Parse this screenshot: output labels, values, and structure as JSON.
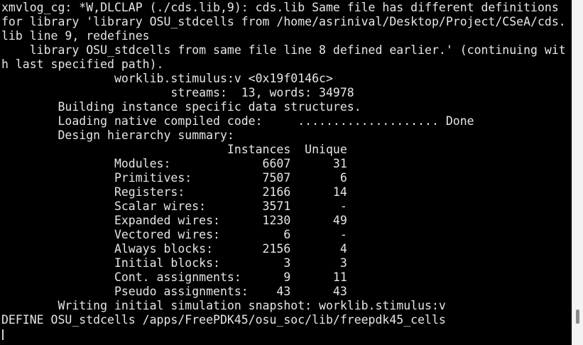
{
  "terminal": {
    "lines": [
      "xmvlog_cg: *W,DLCLAP (./cds.lib,9): cds.lib Same file has different definitions",
      "for library 'library OSU_stdcells from /home/asrinival/Desktop/Project/CSeA/cds.",
      "lib line 9, redefines",
      "    library OSU_stdcells from same file line 8 defined earlier.' (continuing wit",
      "h last specified path).",
      "                worklib.stimulus:v <0x19f0146c>",
      "                        streams:  13, words: 34978",
      "        Building instance specific data structures.",
      "        Loading native compiled code:     .................... Done",
      "        Design hierarchy summary:",
      "                                Instances  Unique",
      "                Modules:             6607      31",
      "                Primitives:          7507       6",
      "                Registers:           2166      14",
      "                Scalar wires:        3571       -",
      "                Expanded wires:      1230      49",
      "                Vectored wires:         6       -",
      "                Always blocks:       2156       4",
      "                Initial blocks:         3       3",
      "                Cont. assignments:      9      11",
      "                Pseudo assignments:    43      43",
      "        Writing initial simulation snapshot: worklib.stimulus:v",
      "DEFINE OSU_stdcells /apps/FreePDK45/osu_soc/lib/freepdk45_cells"
    ]
  }
}
